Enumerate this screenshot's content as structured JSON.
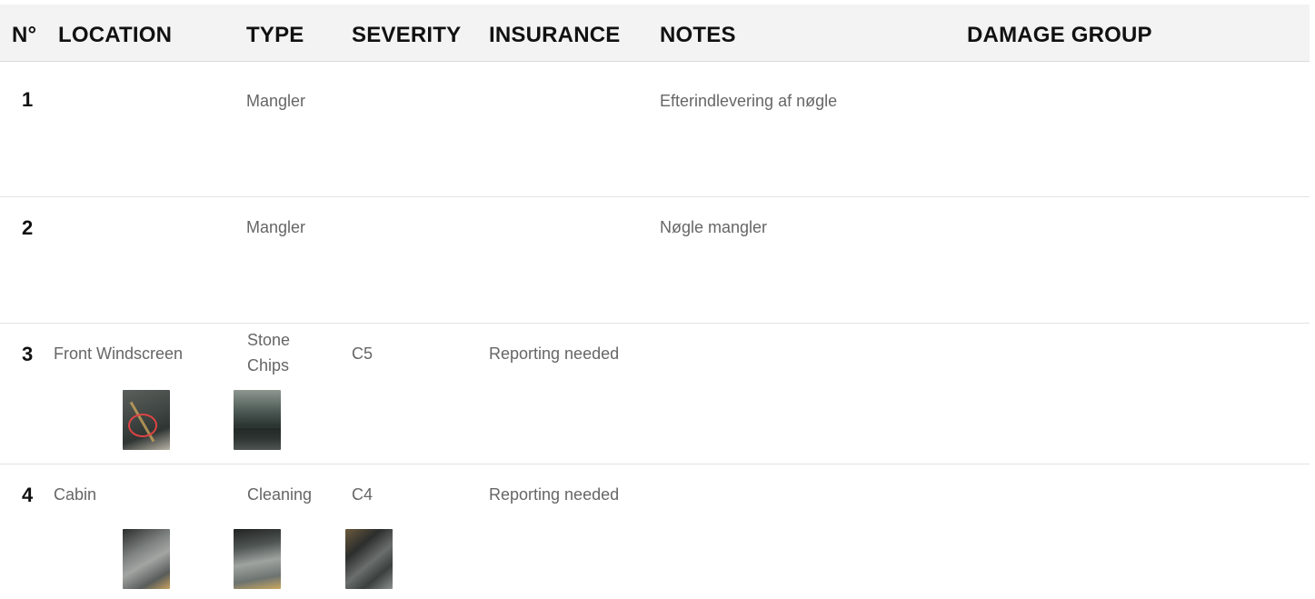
{
  "header": {
    "no": "N°",
    "location": "LOCATION",
    "type": "TYPE",
    "severity": "SEVERITY",
    "insurance": "INSURANCE",
    "notes": "NOTES",
    "damage_group": "DAMAGE GROUP"
  },
  "rows": [
    {
      "no": "1",
      "location": "",
      "type": "Mangler",
      "severity": "",
      "insurance": "",
      "notes": "Efterindlevering af nøgle",
      "damage_group": ""
    },
    {
      "no": "2",
      "location": "",
      "type": "Mangler",
      "severity": "",
      "insurance": "",
      "notes": "Nøgle mangler",
      "damage_group": ""
    },
    {
      "no": "3",
      "location": "Front Windscreen",
      "type_line1": "Stone",
      "type_line2": "Chips",
      "severity": "C5",
      "insurance": "Reporting needed",
      "notes": "",
      "damage_group": "",
      "photos": [
        "windscreen-closeup-photo",
        "windscreen-wide-photo"
      ]
    },
    {
      "no": "4",
      "location": "Cabin",
      "type": "Cleaning",
      "severity": "C4",
      "insurance": "Reporting needed",
      "notes": "",
      "damage_group": "",
      "photos": [
        "cabin-seat-photo",
        "cabin-rear-seat-photo",
        "cabin-floor-photo"
      ]
    }
  ],
  "colors": {
    "header_bg": "#f3f3f3",
    "header_text": "#111111",
    "cell_text": "#666666",
    "row_divider": "#e3e3e3",
    "damage_marker": "#dd4444"
  }
}
